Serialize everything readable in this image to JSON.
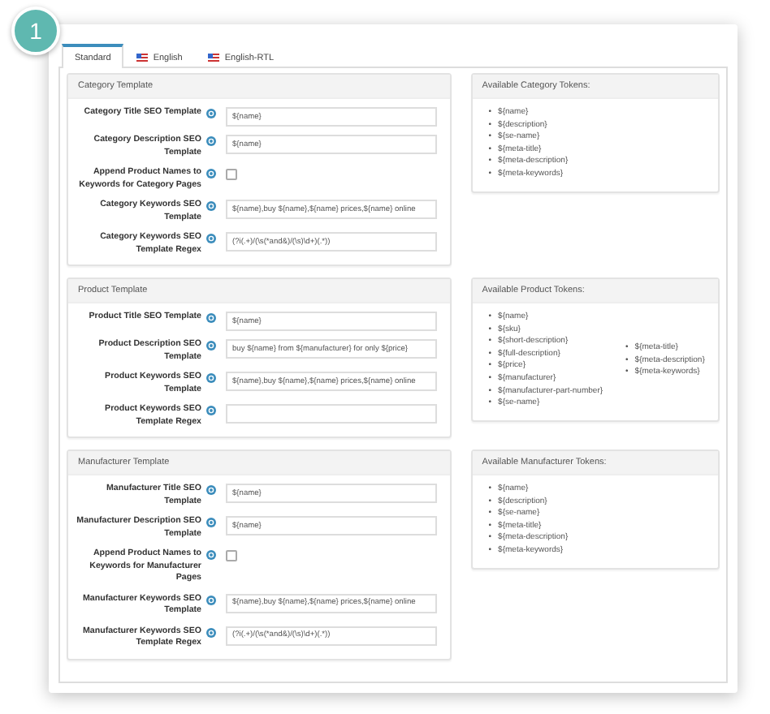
{
  "badge": "1",
  "bullet": "•",
  "tabs": [
    {
      "label": "Standard",
      "selected": true,
      "flag": false
    },
    {
      "label": "English",
      "selected": false,
      "flag": true
    },
    {
      "label": "English-RTL",
      "selected": false,
      "flag": true
    }
  ],
  "sections": [
    {
      "title": "Category Template",
      "rows": [
        {
          "kind": "text",
          "label": "Category Title SEO Template",
          "value": "${name}"
        },
        {
          "kind": "text",
          "label": "Category Description SEO Template",
          "value": "${name}"
        },
        {
          "kind": "checkbox",
          "label": "Append Product Names to Keywords for Category Pages",
          "checked": false
        },
        {
          "kind": "text",
          "label": "Category Keywords SEO Template",
          "value": "${name},buy ${name},${name} prices,${name} online"
        },
        {
          "kind": "text",
          "label": "Category Keywords SEO Template Regex",
          "value": "(?i(.+)/(\\s(*and&)/(\\s)\\d+)(.*))"
        }
      ],
      "tokens_title": "Available Category Tokens:",
      "token_columns": [
        [
          "${name}",
          "${description}",
          "${se-name}",
          "${meta-title}",
          "${meta-description}",
          "${meta-keywords}"
        ]
      ]
    },
    {
      "title": "Product Template",
      "rows": [
        {
          "kind": "text",
          "label": "Product Title SEO Template",
          "value": "${name}"
        },
        {
          "kind": "text",
          "label": "Product Description SEO Template",
          "value": "buy ${name} from ${manufacturer} for only ${price}"
        },
        {
          "kind": "text",
          "label": "Product Keywords SEO Template",
          "value": "${name},buy ${name},${name} prices,${name} online"
        },
        {
          "kind": "text",
          "label": "Product Keywords SEO Template Regex"
        }
      ],
      "tokens_title": "Available Product Tokens:",
      "token_columns": [
        [
          "${name}",
          "${sku}",
          "${short-description}",
          "${full-description}",
          "${price}",
          "${manufacturer}",
          "${manufacturer-part-number}",
          "${se-name}"
        ],
        [
          "${meta-title}",
          "${meta-description}",
          "${meta-keywords}"
        ]
      ]
    },
    {
      "title": "Manufacturer Template",
      "rows": [
        {
          "kind": "text",
          "label": "Manufacturer Title SEO Template",
          "value": "${name}"
        },
        {
          "kind": "text",
          "label": "Manufacturer Description SEO Template",
          "value": "${name}"
        },
        {
          "kind": "checkbox",
          "label": "Append Product Names to Keywords for Manufacturer Pages",
          "checked": false
        },
        {
          "kind": "text",
          "label": "Manufacturer Keywords SEO Template",
          "value": "${name},buy ${name},${name} prices,${name} online"
        },
        {
          "kind": "text",
          "label": "Manufacturer Keywords SEO Template Regex",
          "value": "(?i(.+)/(\\s(*and&)/(\\s)\\d+)(.*))"
        }
      ],
      "tokens_title": "Available Manufacturer Tokens:",
      "token_columns": [
        [
          "${name}",
          "${description}",
          "${se-name}",
          "${meta-title}",
          "${meta-description}",
          "${meta-keywords}"
        ]
      ]
    }
  ]
}
